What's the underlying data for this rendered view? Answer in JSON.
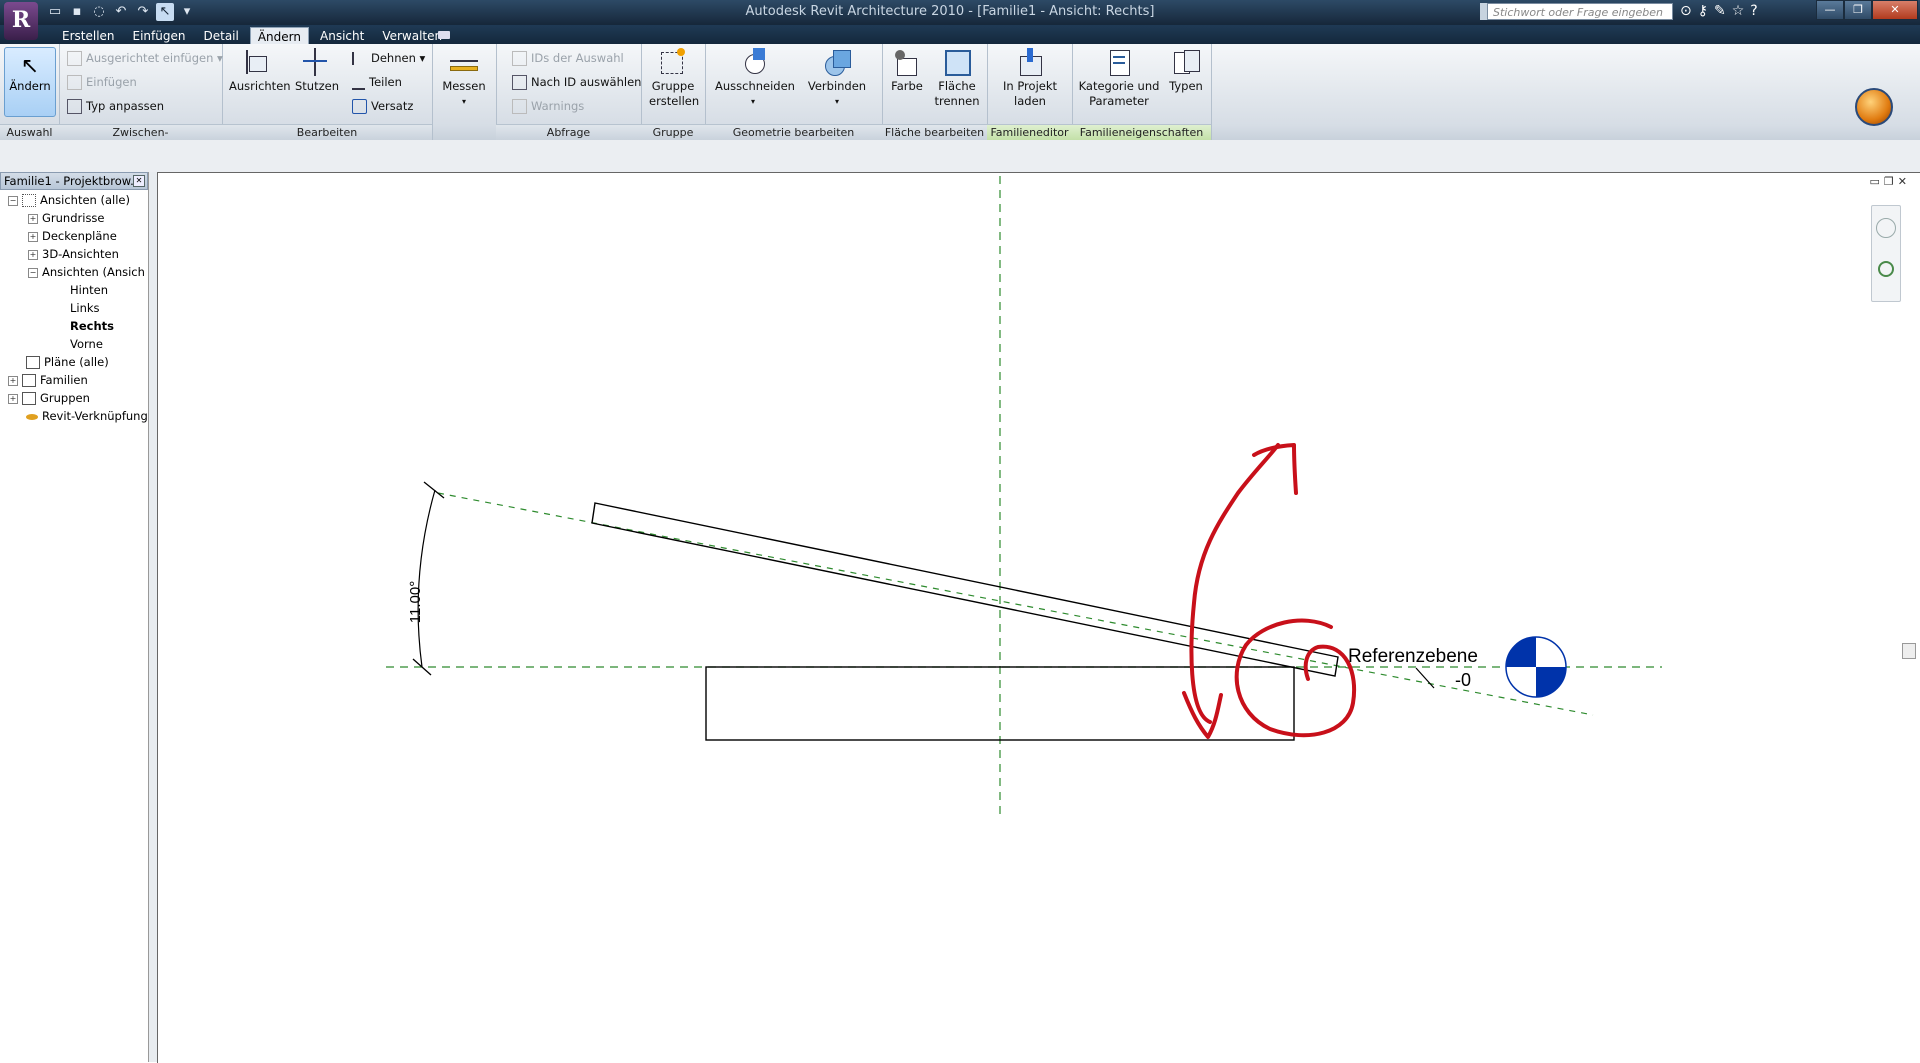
{
  "titlebar": {
    "app_letter": "R",
    "title": "Autodesk Revit Architecture 2010 - [Familie1 - Ansicht: Rechts]",
    "search_placeholder": "Stichwort oder Frage eingeben"
  },
  "tabs": [
    "Erstellen",
    "Einfügen",
    "Detail",
    "Ändern",
    "Ansicht",
    "Verwalten"
  ],
  "active_tab": "Ändern",
  "ribbon": {
    "auswahl": {
      "button": "Ändern",
      "label": "Auswahl"
    },
    "zwischen": {
      "items": [
        "Ausgerichtet einfügen",
        "Einfügen",
        "Typ anpassen"
      ],
      "label": "Zwischen-"
    },
    "bearbeiten": {
      "ausrichten": "Ausrichten",
      "stutzen": "Stutzen",
      "dehnen": "Dehnen",
      "teilen": "Teilen",
      "versatz": "Versatz",
      "label": "Bearbeiten"
    },
    "messen": {
      "button": "Messen"
    },
    "abfrage": {
      "items": [
        "IDs der Auswahl",
        "Nach ID auswählen",
        "Warnings"
      ],
      "label": "Abfrage"
    },
    "gruppe": {
      "line1": "Gruppe",
      "line2": "erstellen",
      "label": "Gruppe"
    },
    "geometrie": {
      "ausschneiden": "Ausschneiden",
      "verbinden": "Verbinden",
      "label": "Geometrie bearbeiten"
    },
    "flaeche": {
      "farbe": "Farbe",
      "trennen_1": "Fläche",
      "trennen_2": "trennen",
      "label": "Fläche bearbeiten"
    },
    "familieneditor": {
      "line1": "In Projekt",
      "line2": "laden",
      "label": "Familieneditor"
    },
    "familieneigenschaften": {
      "kat_1": "Kategorie und",
      "kat_2": "Parameter",
      "typen": "Typen",
      "label": "Familieneigenschaften"
    }
  },
  "browser": {
    "title": "Familie1 - Projektbrow...",
    "items": [
      {
        "label": "Ansichten (alle)",
        "expander": "−"
      },
      {
        "label": "Grundrisse",
        "expander": "+"
      },
      {
        "label": "Deckenpläne",
        "expander": "+"
      },
      {
        "label": "3D-Ansichten",
        "expander": "+"
      },
      {
        "label": "Ansichten (Ansich",
        "expander": "−"
      },
      {
        "label": "Hinten"
      },
      {
        "label": "Links"
      },
      {
        "label": "Rechts"
      },
      {
        "label": "Vorne"
      },
      {
        "label": "Pläne (alle)"
      },
      {
        "label": "Familien",
        "expander": "+"
      },
      {
        "label": "Gruppen",
        "expander": "+"
      },
      {
        "label": "Revit-Verknüpfung"
      }
    ]
  },
  "drawing": {
    "dimension_text": "11.00°",
    "reference_label": "Referenzebene",
    "reference_value": "-0",
    "colors": {
      "ref_line": "#2e8b2e",
      "markup": "#c8101a",
      "symbol": "#0033aa"
    }
  }
}
